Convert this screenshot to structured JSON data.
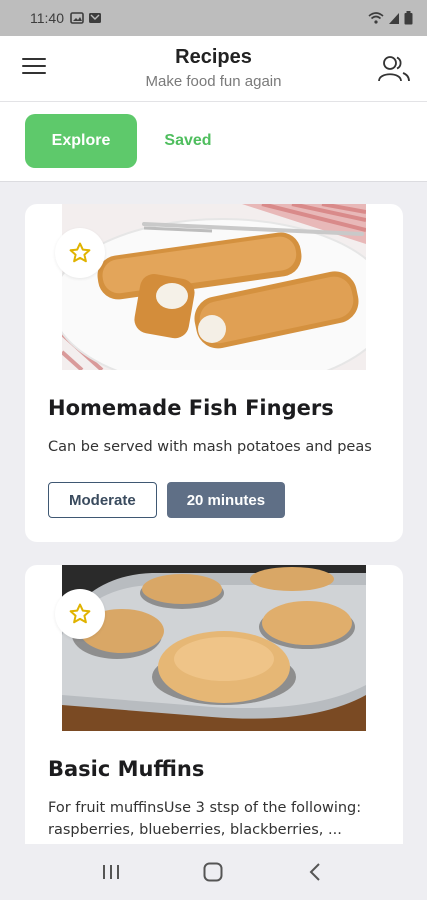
{
  "status_bar": {
    "time": "11:40"
  },
  "header": {
    "title": "Recipes",
    "subtitle": "Make food fun again",
    "menu_icon": "hamburger-menu-icon",
    "profile_icon": "users-icon"
  },
  "tabs": [
    {
      "label": "Explore",
      "active": true
    },
    {
      "label": "Saved",
      "active": false
    }
  ],
  "recipes": [
    {
      "title": "Homemade Fish Fingers",
      "description": "Can be served with mash potatoes and peas",
      "difficulty": "Moderate",
      "time": "20 minutes",
      "image": "fish-fingers-photo"
    },
    {
      "title": "Basic Muffins",
      "description": "For fruit muffinsUse 3 stsp of the following: raspberries, blueberries, blackberries, ...",
      "image": "muffins-photo"
    }
  ],
  "colors": {
    "accent": "#5ec96b",
    "badge_outline": "#3f5873",
    "badge_fill": "#5f6f86",
    "star": "#e0b300"
  }
}
